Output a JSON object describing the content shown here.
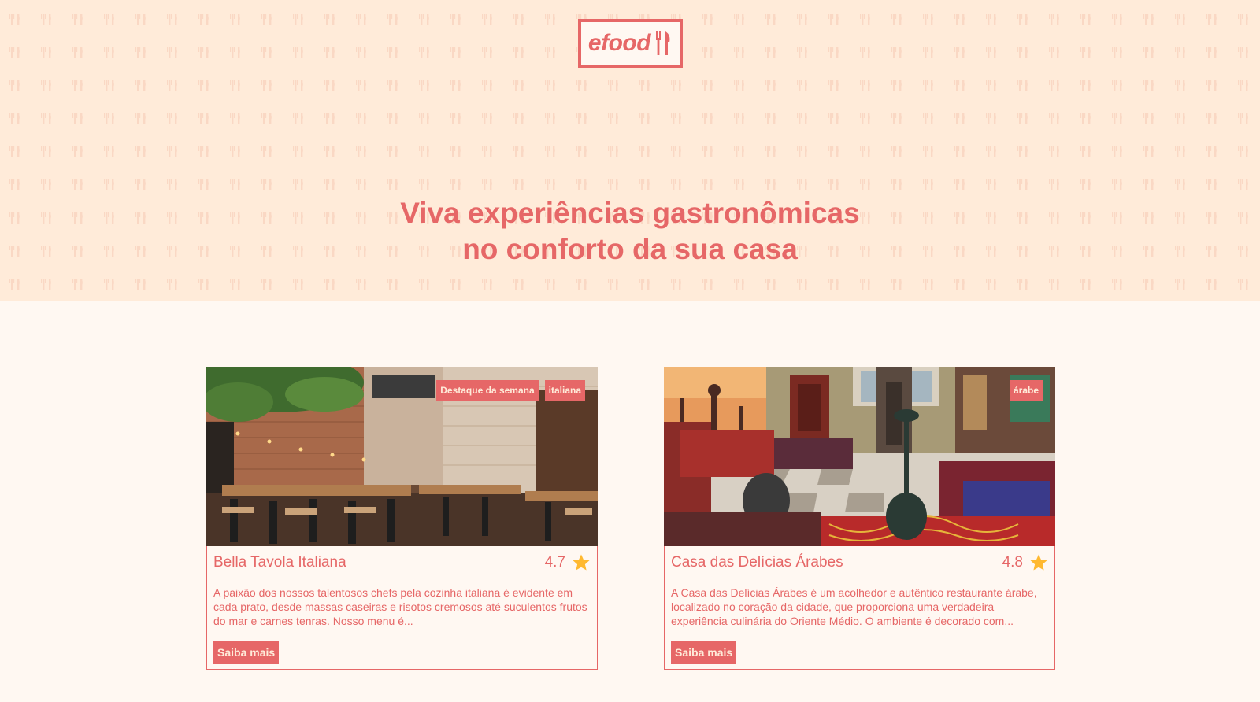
{
  "brand": {
    "logo_text": "efood"
  },
  "hero": {
    "headline_line1": "Viva experiências gastronômicas",
    "headline_line2": "no conforto da sua casa"
  },
  "colors": {
    "primary": "#e66767",
    "hero_bg": "#ffebd9",
    "page_bg": "#fff8f2",
    "star": "#ffb930"
  },
  "restaurants": [
    {
      "name": "Bella Tavola Italiana",
      "rating": "4.7",
      "tags": [
        "Destaque da semana",
        "italiana"
      ],
      "description": "A paixão dos nossos talentosos chefs pela cozinha italiana é evidente em cada prato, desde massas caseiras e risotos cremosos até suculentos frutos do mar e carnes tenras. Nosso menu é...",
      "button": "Saiba mais",
      "image": "italian-restaurant-interior-photo"
    },
    {
      "name": "Casa das Delícias Árabes",
      "rating": "4.8",
      "tags": [
        "árabe"
      ],
      "description": "A Casa das Delícias Árabes é um acolhedor e autêntico restaurante árabe, localizado no coração da cidade, que proporciona uma verdadeira experiência culinária do Oriente Médio. O ambiente é decorado com...",
      "button": "Saiba mais",
      "image": "arabic-restaurant-interior-photo"
    }
  ]
}
